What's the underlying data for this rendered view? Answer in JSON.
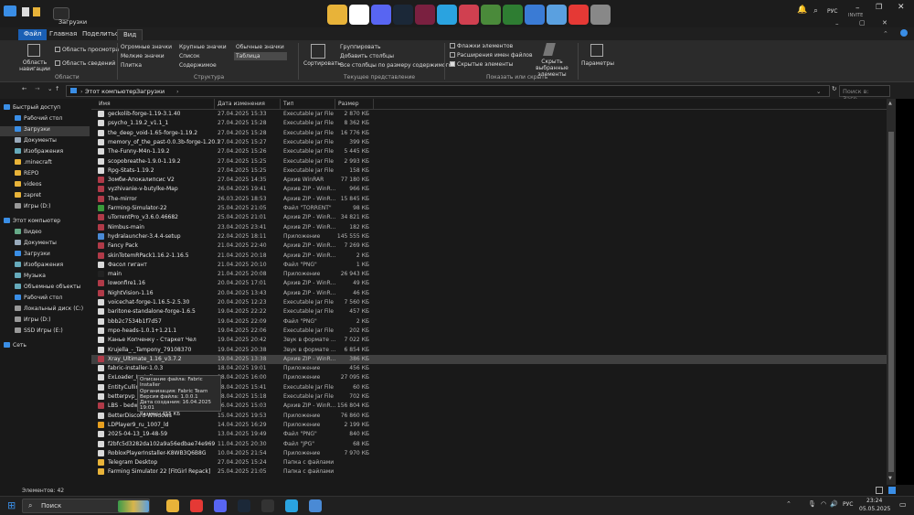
{
  "window": {
    "title": "Загрузки"
  },
  "topbar": {
    "apps": [
      {
        "name": "explorer-icon",
        "color": "#e8b339"
      },
      {
        "name": "yandex-icon",
        "color": "#ffffff"
      },
      {
        "name": "discord-icon",
        "color": "#5865f2"
      },
      {
        "name": "steam-icon",
        "color": "#1b2838"
      },
      {
        "name": "app-icon",
        "color": "#7a2040"
      },
      {
        "name": "telegram-icon",
        "color": "#2aa3e0"
      },
      {
        "name": "app-icon",
        "color": "#d04050"
      },
      {
        "name": "minecraft-icon",
        "color": "#4a8a3a"
      },
      {
        "name": "app-icon",
        "color": "#2e7d32"
      },
      {
        "name": "app-icon",
        "color": "#3a7bd5"
      },
      {
        "name": "app-icon",
        "color": "#5aa0e0"
      },
      {
        "name": "app-icon",
        "color": "#e53935"
      },
      {
        "name": "app-icon",
        "color": "#888888"
      }
    ],
    "lang": "РУС",
    "invite": "INVITE"
  },
  "ribbon": {
    "tabs": [
      "Файл",
      "Главная",
      "Поделиться",
      "Вид"
    ],
    "panes": {
      "nav": "Область навигации",
      "preview": "Область просмотра",
      "details": "Область сведений",
      "group": "Области"
    },
    "layout": {
      "huge": "Огромные значки",
      "large": "Крупные значки",
      "normal": "Обычные значки",
      "small": "Мелкие значки",
      "list": "Список",
      "table": "Таблица",
      "tiles": "Плитка",
      "content": "Содержимое",
      "group": "Структура"
    },
    "view": {
      "sort": "Сортировать",
      "groupby": "Группировать",
      "addcols": "Добавить столбцы",
      "fitcols": "Все столбцы по размеру содержимого",
      "group": "Текущее представление"
    },
    "show": {
      "checkboxes": "Флажки элементов",
      "ext": "Расширения имен файлов",
      "hidden": "Скрытые элементы",
      "hide_sel": "Скрыть выбранные элементы",
      "group": "Показать или скрыть"
    },
    "options": "Параметры"
  },
  "address": {
    "path1": "Этот компьютер",
    "path2": "Загрузки",
    "search_placeholder": "Поиск в: Загр..."
  },
  "nav": [
    {
      "label": "Быстрый доступ",
      "color": "#3a8ee6",
      "indent": 0
    },
    {
      "label": "Рабочий стол",
      "color": "#3a8ee6",
      "indent": 1
    },
    {
      "label": "Загрузки",
      "color": "#3a8ee6",
      "indent": 1,
      "selected": true
    },
    {
      "label": "Документы",
      "color": "#9ab",
      "indent": 1
    },
    {
      "label": "Изображения",
      "color": "#6ab",
      "indent": 1
    },
    {
      "label": ".minecraft",
      "color": "#e8b339",
      "indent": 1
    },
    {
      "label": "REPO",
      "color": "#e8b339",
      "indent": 1
    },
    {
      "label": "videos",
      "color": "#e8b339",
      "indent": 1
    },
    {
      "label": "zapret",
      "color": "#e8b339",
      "indent": 1
    },
    {
      "label": "Игры (D:)",
      "color": "#999",
      "indent": 1
    },
    {
      "label": "Этот компьютер",
      "color": "#3a8ee6",
      "indent": 0
    },
    {
      "label": "Видео",
      "color": "#6a8",
      "indent": 1
    },
    {
      "label": "Документы",
      "color": "#9ab",
      "indent": 1
    },
    {
      "label": "Загрузки",
      "color": "#3a8ee6",
      "indent": 1
    },
    {
      "label": "Изображения",
      "color": "#6ab",
      "indent": 1
    },
    {
      "label": "Музыка",
      "color": "#6ab",
      "indent": 1
    },
    {
      "label": "Объемные объекты",
      "color": "#6ab",
      "indent": 1
    },
    {
      "label": "Рабочий стол",
      "color": "#3a8ee6",
      "indent": 1
    },
    {
      "label": "Локальный диск (C:)",
      "color": "#999",
      "indent": 1
    },
    {
      "label": "Игры (D:)",
      "color": "#999",
      "indent": 1
    },
    {
      "label": "SSD Игры (E:)",
      "color": "#999",
      "indent": 1
    },
    {
      "label": "Сеть",
      "color": "#3a8ee6",
      "indent": 0
    }
  ],
  "columns": {
    "name": "Имя",
    "date": "Дата изменения",
    "type": "Тип",
    "size": "Размер"
  },
  "files": [
    {
      "name": "geckolib-forge-1.19-3.1.40",
      "date": "27.04.2025 15:33",
      "type": "Executable Jar File",
      "size": "2 870 КБ",
      "color": "#d9d9d9"
    },
    {
      "name": "psycho_1.19.2_v1.1_1",
      "date": "27.04.2025 15:28",
      "type": "Executable Jar File",
      "size": "8 362 КБ",
      "color": "#d9d9d9"
    },
    {
      "name": "the_deep_void-1.65-forge-1.19.2",
      "date": "27.04.2025 15:28",
      "type": "Executable Jar File",
      "size": "16 776 КБ",
      "color": "#d9d9d9"
    },
    {
      "name": "memory_of_the_past-0.0.3b-forge-1.20.1",
      "date": "27.04.2025 15:27",
      "type": "Executable Jar File",
      "size": "399 КБ",
      "color": "#d9d9d9"
    },
    {
      "name": "The-Funny-M4n-1.19.2",
      "date": "27.04.2025 15:26",
      "type": "Executable Jar File",
      "size": "5 445 КБ",
      "color": "#d9d9d9"
    },
    {
      "name": "scopobreathe-1.9.0-1.19.2",
      "date": "27.04.2025 15:25",
      "type": "Executable Jar File",
      "size": "2 993 КБ",
      "color": "#d9d9d9"
    },
    {
      "name": "Rpg-Stats-1.19.2",
      "date": "27.04.2025 15:25",
      "type": "Executable Jar File",
      "size": "158 КБ",
      "color": "#d9d9d9"
    },
    {
      "name": "Зомби-Апокалипсис V2",
      "date": "27.04.2025 14:35",
      "type": "Архив WinRAR",
      "size": "77 180 КБ",
      "color": "#b03a48"
    },
    {
      "name": "vyzhivanie-v-butylke-Map",
      "date": "26.04.2025 19:41",
      "type": "Архив ZIP - WinR...",
      "size": "966 КБ",
      "color": "#b03a48"
    },
    {
      "name": "The-mirror",
      "date": "26.03.2025 18:53",
      "type": "Архив ZIP - WinR...",
      "size": "15 845 КБ",
      "color": "#b03a48"
    },
    {
      "name": "Farming-Simulator-22",
      "date": "25.04.2025 21:05",
      "type": "Файл \"TORRENT\"",
      "size": "98 КБ",
      "color": "#3a9a3a"
    },
    {
      "name": "uTorrentPro_v3.6.0.46682",
      "date": "25.04.2025 21:01",
      "type": "Архив ZIP - WinR...",
      "size": "34 821 КБ",
      "color": "#b03a48"
    },
    {
      "name": "Nimbus-main",
      "date": "23.04.2025 23:41",
      "type": "Архив ZIP - WinR...",
      "size": "182 КБ",
      "color": "#b03a48"
    },
    {
      "name": "hydralauncher-3.4.4-setup",
      "date": "22.04.2025 18:11",
      "type": "Приложение",
      "size": "145 555 КБ",
      "color": "#4a8ad5"
    },
    {
      "name": "Fancy Pack",
      "date": "21.04.2025 22:40",
      "type": "Архив ZIP - WinR...",
      "size": "7 269 КБ",
      "color": "#b03a48"
    },
    {
      "name": "skinTotemRPack1.16.2-1.16.5",
      "date": "21.04.2025 20:18",
      "type": "Архив ZIP - WinR...",
      "size": "2 КБ",
      "color": "#b03a48"
    },
    {
      "name": "Фасол гигант",
      "date": "21.04.2025 20:10",
      "type": "Файл \"PNG\"",
      "size": "1 КБ",
      "color": "#d9d9d9"
    },
    {
      "name": "main",
      "date": "21.04.2025 20:08",
      "type": "Приложение",
      "size": "26 943 КБ",
      "color": "#222222"
    },
    {
      "name": "lowonfire1.16",
      "date": "20.04.2025 17:01",
      "type": "Архив ZIP - WinR...",
      "size": "49 КБ",
      "color": "#b03a48"
    },
    {
      "name": "NightVision-1.16",
      "date": "20.04.2025 13:43",
      "type": "Архив ZIP - WinR...",
      "size": "46 КБ",
      "color": "#b03a48"
    },
    {
      "name": "voicechat-forge-1.16.5-2.5.30",
      "date": "20.04.2025 12:23",
      "type": "Executable Jar File",
      "size": "7 560 КБ",
      "color": "#d9d9d9"
    },
    {
      "name": "baritone-standalone-forge-1.6.5",
      "date": "19.04.2025 22:22",
      "type": "Executable Jar File",
      "size": "457 КБ",
      "color": "#d9d9d9"
    },
    {
      "name": "bbb2c7534b1f7d57",
      "date": "19.04.2025 22:09",
      "type": "Файл \"PNG\"",
      "size": "2 КБ",
      "color": "#d9d9d9"
    },
    {
      "name": "mpo-heads-1.0.1+1.21.1",
      "date": "19.04.2025 22:06",
      "type": "Executable Jar File",
      "size": "202 КБ",
      "color": "#d9d9d9"
    },
    {
      "name": "Канье Копченку - Старкет Чел",
      "date": "19.04.2025 20:42",
      "type": "Звук в формате ...",
      "size": "7 022 КБ",
      "color": "#d9d9d9"
    },
    {
      "name": "Krujella_-_Tampony_79108370",
      "date": "19.04.2025 20:38",
      "type": "Звук в формате ...",
      "size": "6 854 КБ",
      "color": "#d9d9d9"
    },
    {
      "name": "Xray_Ultimate_1.16_v3.7.2",
      "date": "19.04.2025 13:38",
      "type": "Архив ZIP - WinR...",
      "size": "386 КБ",
      "color": "#b03a48",
      "selected": true
    },
    {
      "name": "fabric-installer-1.0.3",
      "date": "18.04.2025 19:01",
      "type": "Приложение",
      "size": "456 КБ",
      "color": "#d9d9d9"
    },
    {
      "name": "ExLoader_Installer",
      "date": "18.04.2025 16:00",
      "type": "Приложение",
      "size": "27 095 КБ",
      "color": "#d9d9d9"
    },
    {
      "name": "EntityCulling",
      "date": "18.04.2025 15:41",
      "type": "Executable Jar File",
      "size": "60 КБ",
      "color": "#d9d9d9"
    },
    {
      "name": "betterpvp_2",
      "date": "18.04.2025 15:18",
      "type": "Executable Jar File",
      "size": "702 КБ",
      "color": "#d9d9d9"
    },
    {
      "name": "LBS - bedwars",
      "date": "16.04.2025 15:03",
      "type": "Архив ZIP - WinR...",
      "size": "156 804 КБ",
      "color": "#b03a48"
    },
    {
      "name": "BetterDiscord-Windows",
      "date": "15.04.2025 19:53",
      "type": "Приложение",
      "size": "76 860 КБ",
      "color": "#d9d9d9"
    },
    {
      "name": "LDPlayer9_ru_1007_ld",
      "date": "14.04.2025 16:29",
      "type": "Приложение",
      "size": "2 199 КБ",
      "color": "#e8a020"
    },
    {
      "name": "2025-04-13_19-48-59",
      "date": "13.04.2025 19:49",
      "type": "Файл \"PNG\"",
      "size": "840 КБ",
      "color": "#d9d9d9"
    },
    {
      "name": "f2bfc5d3282da102a9a56edbae74e969",
      "date": "11.04.2025 20:30",
      "type": "Файл \"JPG\"",
      "size": "68 КБ",
      "color": "#d9d9d9"
    },
    {
      "name": "RobloxPlayerInstaller-K8WB3Q6B8G",
      "date": "10.04.2025 21:54",
      "type": "Приложение",
      "size": "7 970 КБ",
      "color": "#d9d9d9"
    },
    {
      "name": "Telegram Desktop",
      "date": "27.04.2025 15:24",
      "type": "Папка с файлами",
      "size": "",
      "color": "#e8b339"
    },
    {
      "name": "Farming Simulator 22 [FitGirl Repack]",
      "date": "25.04.2025 21:05",
      "type": "Папка с файлами",
      "size": "",
      "color": "#e8b339"
    }
  ],
  "tooltip": {
    "l1": "Описание файла: Fabric Installer",
    "l2": "Организация: Fabric Team",
    "l3": "Версия файла: 1.0.0.1",
    "l4": "Дата создания: 16.04.2025 19:01",
    "l5": "Размер: 455 КБ"
  },
  "status": {
    "count": "Элементов: 42"
  },
  "taskbar": {
    "search": "Поиск",
    "lang": "РУС",
    "time": "23:24",
    "date": "05.05.2025",
    "apps": [
      {
        "name": "explorer-icon",
        "color": "#e8b339"
      },
      {
        "name": "yandex-icon",
        "color": "#e53935"
      },
      {
        "name": "discord-icon",
        "color": "#5865f2"
      },
      {
        "name": "steam-icon",
        "color": "#1b2838"
      },
      {
        "name": "app-icon",
        "color": "#333333"
      },
      {
        "name": "telegram-icon",
        "color": "#2aa3e0"
      },
      {
        "name": "explorer-icon",
        "color": "#4a8ad5"
      }
    ]
  }
}
